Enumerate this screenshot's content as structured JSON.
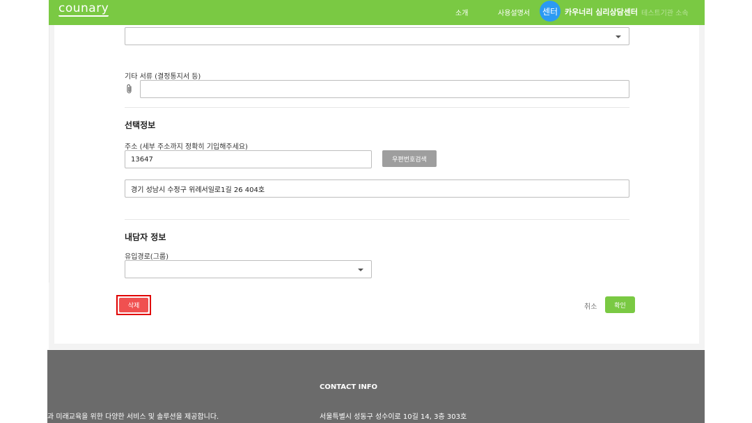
{
  "header": {
    "logo": "counary",
    "nav": [
      "소개",
      "사용설명서"
    ],
    "avatar": "센터",
    "center_name": "카우너리 심리상담센터",
    "test_link": "테스트기관 소속"
  },
  "form": {
    "other_docs_label": "기타 서류 (결정통지서 등)",
    "optional_title": "선택정보",
    "address_label": "주소 (세부 주소까지 정확히 기입해주세요)",
    "zipcode_value": "13647",
    "zip_search_label": "우편번호검색",
    "address_value": "경기 성남시 수정구 위례서일로1길 26 404호",
    "client_title": "내담자 정보",
    "source_label": "유입경로(그룹)"
  },
  "actions": {
    "delete_label": "삭제",
    "cancel_label": "취소",
    "confirm_label": "확인"
  },
  "footer": {
    "contact_heading": "CONTACT INFO",
    "description": "과 미래교육을 위한 다양한 서비스 및 솔루션을 제공합니다.",
    "address": "서울특별시 성동구 성수이로 10길 14, 3층 303호"
  },
  "colors": {
    "brand_green": "#7ac943",
    "avatar_blue": "#2b9af3",
    "delete_red": "#f05050",
    "highlight_red": "#e00000"
  }
}
